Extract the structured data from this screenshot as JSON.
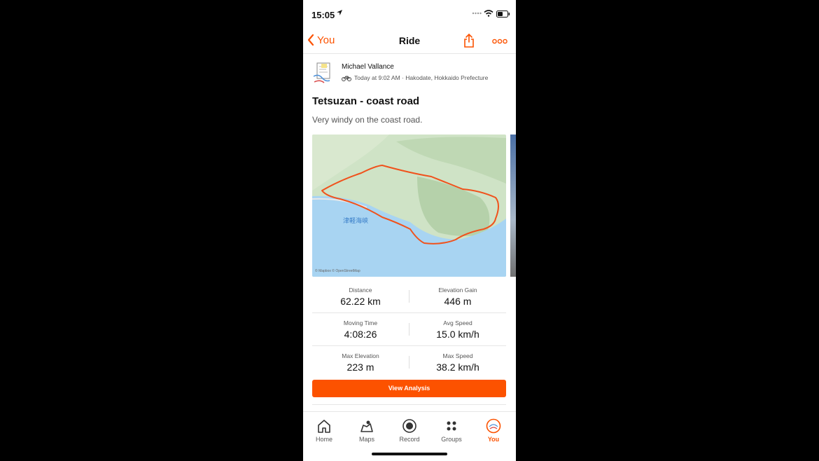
{
  "status": {
    "time": "15:05"
  },
  "nav": {
    "back_label": "You",
    "title": "Ride"
  },
  "activity": {
    "athlete_name": "Michael Vallance",
    "meta": "Today at 9:02 AM · Hakodate, Hokkaido Prefecture",
    "title": "Tetsuzan - coast road",
    "description": "Very windy on the coast road.",
    "map_sea_label": "津軽海峡",
    "map_attribution": "© Mapbox © OpenStreetMap"
  },
  "stats": [
    [
      {
        "label": "Distance",
        "value": "62.22 km"
      },
      {
        "label": "Elevation Gain",
        "value": "446 m"
      }
    ],
    [
      {
        "label": "Moving Time",
        "value": "4:08:26"
      },
      {
        "label": "Avg Speed",
        "value": "15.0 km/h"
      }
    ],
    [
      {
        "label": "Max Elevation",
        "value": "223 m"
      },
      {
        "label": "Max Speed",
        "value": "38.2 km/h"
      }
    ]
  ],
  "actions": {
    "view_analysis": "View Analysis"
  },
  "tabs": [
    {
      "label": "Home",
      "icon": "home-icon"
    },
    {
      "label": "Maps",
      "icon": "maps-icon"
    },
    {
      "label": "Record",
      "icon": "record-icon"
    },
    {
      "label": "Groups",
      "icon": "groups-icon"
    },
    {
      "label": "You",
      "icon": "profile-icon",
      "active": true
    }
  ],
  "colors": {
    "accent": "#fc5200",
    "route": "#f0521c",
    "sea": "#a8d4f2",
    "land": "#cfe3c6"
  }
}
